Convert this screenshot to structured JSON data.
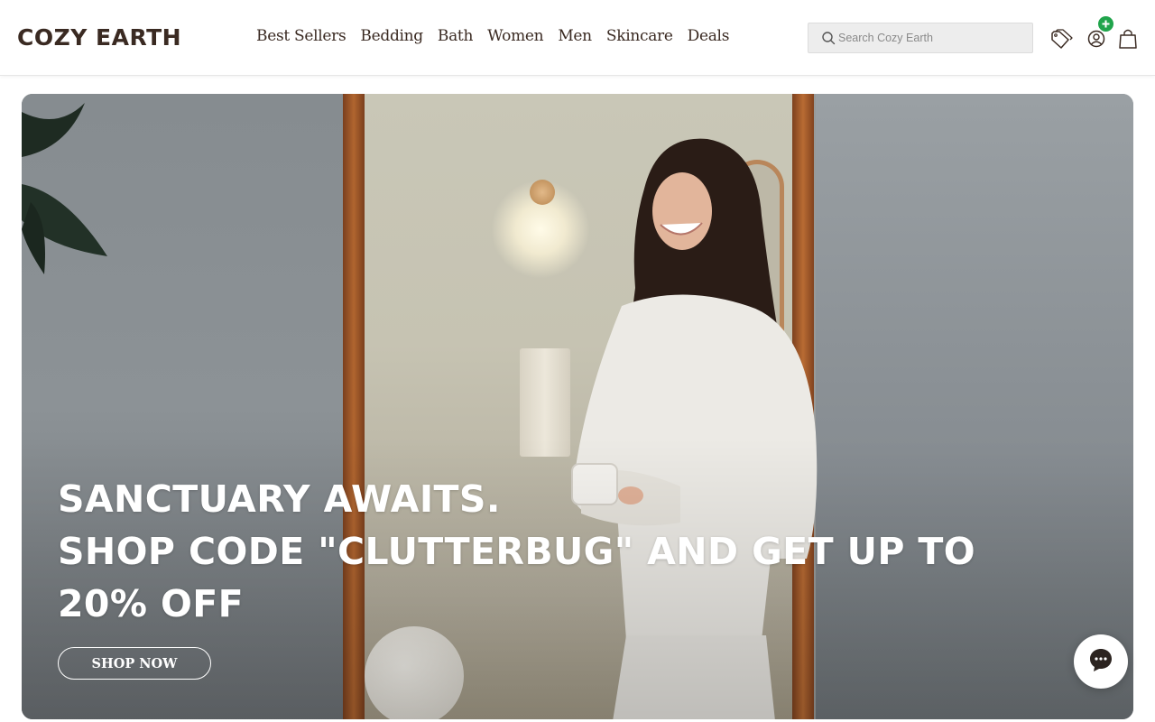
{
  "brand": {
    "logo_text": "COZY EARTH",
    "color": "#3a2a22"
  },
  "nav": {
    "items": [
      {
        "label": "Best Sellers"
      },
      {
        "label": "Bedding"
      },
      {
        "label": "Bath"
      },
      {
        "label": "Women"
      },
      {
        "label": "Men"
      },
      {
        "label": "Skincare"
      },
      {
        "label": "Deals"
      }
    ]
  },
  "search": {
    "placeholder": "Search Cozy Earth",
    "value": ""
  },
  "header_icons": {
    "tag": "tag-icon",
    "account": "account-icon",
    "cart": "cart-icon",
    "badge": "plus-badge",
    "badge_color": "#20a44b"
  },
  "hero": {
    "headline_lines": [
      "SANCTUARY AWAITS.",
      "SHOP CODE \"CLUTTERBUG\" AND GET UP TO",
      "20% OFF"
    ],
    "cta_label": "SHOP NOW"
  },
  "chat": {
    "icon": "chat-icon"
  }
}
